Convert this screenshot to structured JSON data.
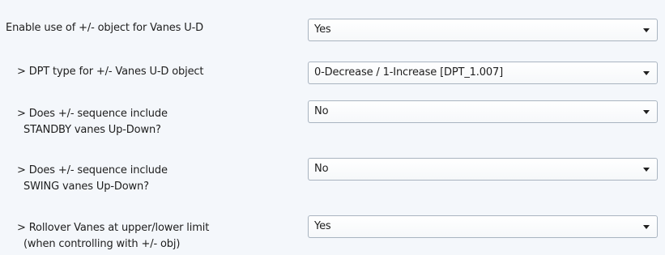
{
  "rows": [
    {
      "label": [
        "Enable use of +/- object for Vanes U-D"
      ],
      "value": "Yes"
    },
    {
      "label": [
        "> DPT type for +/- Vanes U-D object"
      ],
      "value": "0-Decrease / 1-Increase [DPT_1.007]"
    },
    {
      "label": [
        "> Does +/- sequence include",
        "STANDBY vanes Up-Down?"
      ],
      "value": "No"
    },
    {
      "label": [
        "> Does +/- sequence include",
        "SWING vanes Up-Down?"
      ],
      "value": "No"
    },
    {
      "label": [
        "> Rollover Vanes at upper/lower limit",
        "(when controlling with +/- obj)"
      ],
      "value": "Yes"
    }
  ],
  "icons": {
    "dropdown": "chevron-down-icon"
  }
}
